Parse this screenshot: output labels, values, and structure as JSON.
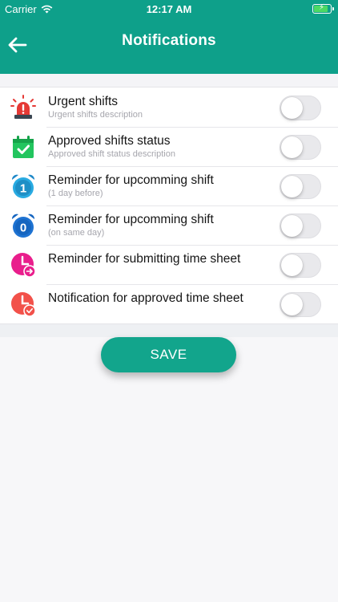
{
  "status_bar": {
    "carrier": "Carrier",
    "time": "12:17 AM",
    "battery_level": 0.75
  },
  "header": {
    "title": "Notifications",
    "back_icon": "arrow-left-icon"
  },
  "colors": {
    "primary": "#0ea08a",
    "save_button": "#12a58c"
  },
  "items": [
    {
      "label": "Urgent shifts",
      "description": "Urgent shifts description",
      "icon": "siren-icon",
      "enabled": false
    },
    {
      "label": "Approved shifts status",
      "description": "Approved shift status description",
      "icon": "calendar-check-icon",
      "enabled": false
    },
    {
      "label": "Reminder for upcomming shift",
      "description": "(1 day before)",
      "icon": "alarm-clock-1-icon",
      "enabled": false
    },
    {
      "label": "Reminder for upcomming shift",
      "description": "(on same day)",
      "icon": "alarm-clock-0-icon",
      "enabled": false
    },
    {
      "label": "Reminder for submitting time sheet",
      "description": "",
      "icon": "clock-submit-icon",
      "enabled": false
    },
    {
      "label": "Notification for approved time sheet",
      "description": "",
      "icon": "clock-approved-icon",
      "enabled": false
    }
  ],
  "save_button": {
    "label": "SAVE"
  }
}
